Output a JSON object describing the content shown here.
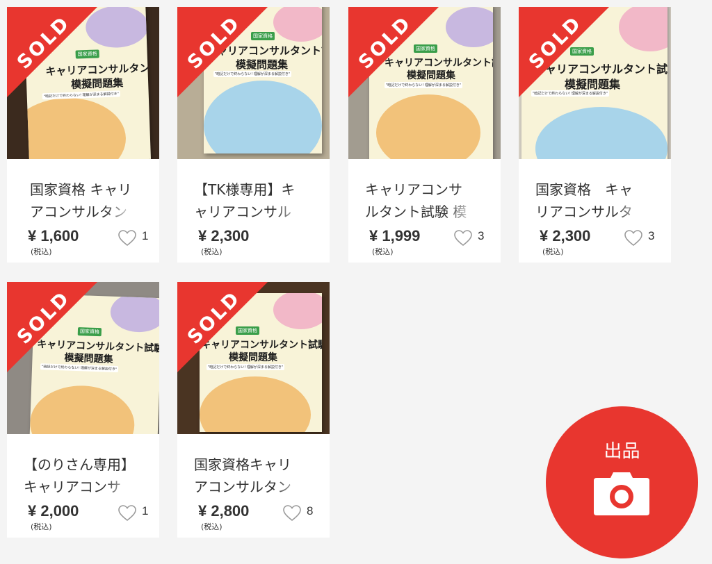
{
  "products": [
    {
      "title": "国家資格 キャリアコンサルタント試験 模擬問題集",
      "price": "¥ 1,600",
      "tax": "(税込)",
      "likes": "1",
      "sold": "SOLD",
      "photo_bg": "#3b2a1e"
    },
    {
      "title": "【TK様専用】キャリアコンサルタント試験",
      "price": "¥ 2,300",
      "tax": "(税込)",
      "likes": "",
      "sold": "SOLD",
      "photo_bg": "#b8ad96"
    },
    {
      "title": "キャリアコンサルタント試験 模擬問題集",
      "price": "¥ 1,999",
      "tax": "(税込)",
      "likes": "3",
      "sold": "SOLD",
      "photo_bg": "#a29c90"
    },
    {
      "title": "国家資格　キャリアコンサルタント",
      "price": "¥ 2,300",
      "tax": "(税込)",
      "likes": "3",
      "sold": "SOLD",
      "photo_bg": "#d8d3c8"
    },
    {
      "title": "【のりさん専用】キャリアコンサルタント",
      "price": "¥ 2,000",
      "tax": "(税込)",
      "likes": "1",
      "sold": "SOLD",
      "photo_bg": "#8f8a84"
    },
    {
      "title": "国家資格キャリアコンサルタント試験",
      "price": "¥ 2,800",
      "tax": "(税込)",
      "likes": "8",
      "sold": "SOLD",
      "photo_bg": "#4a3422"
    }
  ],
  "book": {
    "tag": "国家資格",
    "title_line1": "キャリアコンサルタント試験",
    "title_line2": "模擬問題集",
    "subtitle": "\"暗記だけで終わらない! 理解が深まる解説付き\""
  },
  "sell_button": {
    "label": "出品",
    "icon": "camera-icon"
  },
  "colors": {
    "accent": "#e8362f",
    "background": "#f4f4f4",
    "card": "#ffffff",
    "text": "#333333"
  }
}
